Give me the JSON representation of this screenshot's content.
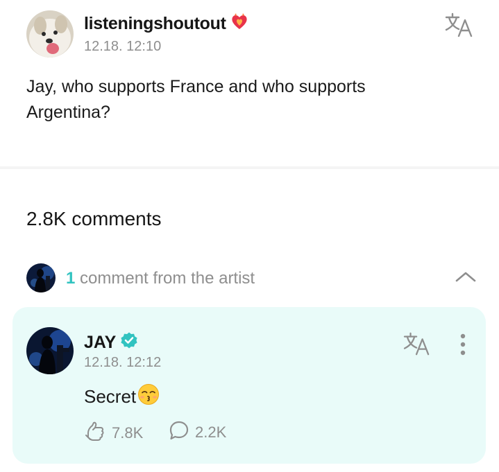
{
  "post": {
    "username": "listeningshoutout",
    "badge_icon": "heart-flame-badge-icon",
    "timestamp": "12.18. 12:10",
    "text": "Jay, who supports France and who supports Argentina?",
    "translate_icon": "translate-icon"
  },
  "comments": {
    "count_label": "2.8K comments"
  },
  "artist_section": {
    "count": "1",
    "label": "comment from the artist",
    "toggle_icon": "chevron-up-icon"
  },
  "artist_comment": {
    "name": "JAY",
    "verified_icon": "verified-check-icon",
    "timestamp": "12.18. 12:12",
    "text": "Secret",
    "emoji": "😙",
    "likes": "7.8K",
    "replies": "2.2K",
    "like_icon": "like-hand-icon",
    "reply_icon": "speech-bubble-icon",
    "more_icon": "more-vertical-icon"
  },
  "colors": {
    "accent": "#31c3c0",
    "card_background": "#e9fbf9",
    "muted_text": "#8e8e8e",
    "badge_red": "#e8334a"
  }
}
